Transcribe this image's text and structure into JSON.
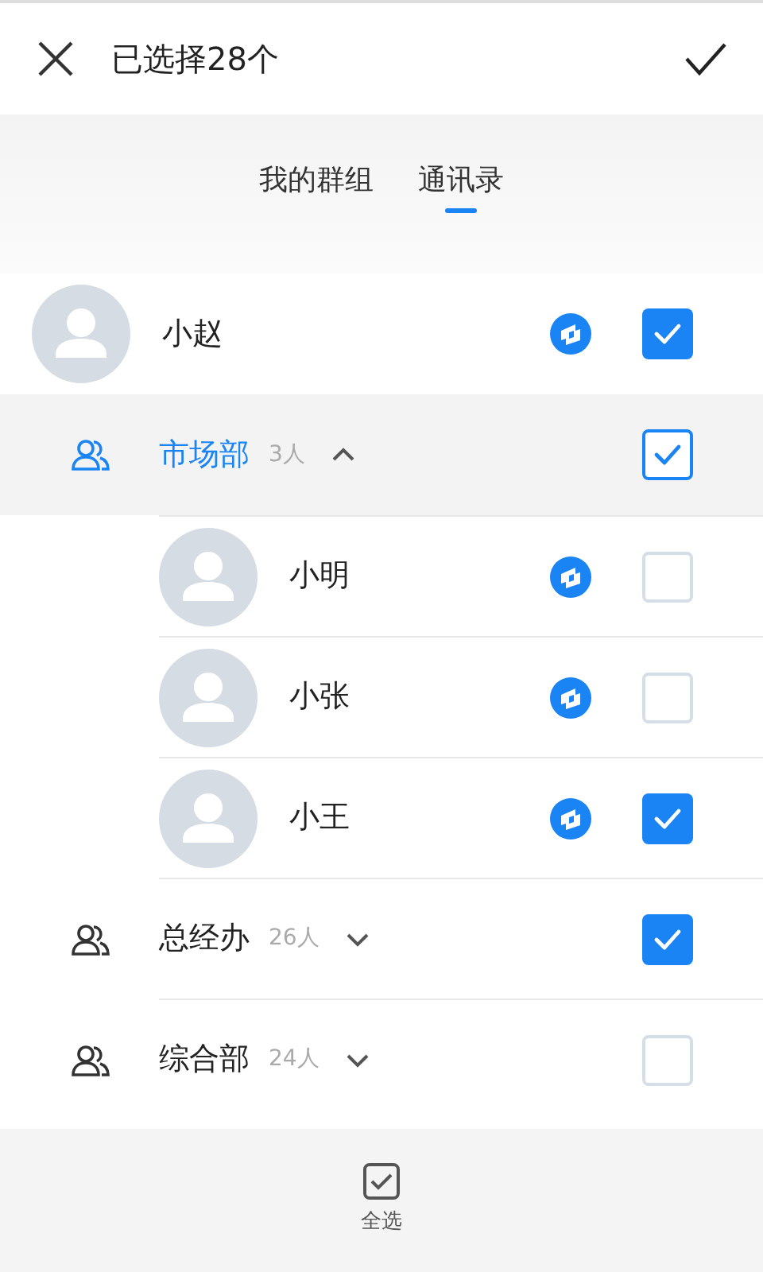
{
  "header": {
    "title": "已选择28个"
  },
  "tabs": [
    {
      "label": "我的群组",
      "selected": false
    },
    {
      "label": "通讯录",
      "selected": true
    }
  ],
  "contacts": [
    {
      "kind": "person",
      "name": "小赵",
      "checked": true
    },
    {
      "kind": "group",
      "name": "市场部",
      "count": "3人",
      "selected": true,
      "expanded": true,
      "checked": true,
      "children": [
        {
          "name": "小明",
          "checked": false
        },
        {
          "name": "小张",
          "checked": false
        },
        {
          "name": "小王",
          "checked": true
        }
      ]
    },
    {
      "kind": "group",
      "name": "总经办",
      "count": "26人",
      "selected": false,
      "expanded": false,
      "checked": true
    },
    {
      "kind": "group",
      "name": "综合部",
      "count": "24人",
      "selected": false,
      "expanded": false,
      "checked": false
    }
  ],
  "footer": {
    "select_all": "全选"
  }
}
